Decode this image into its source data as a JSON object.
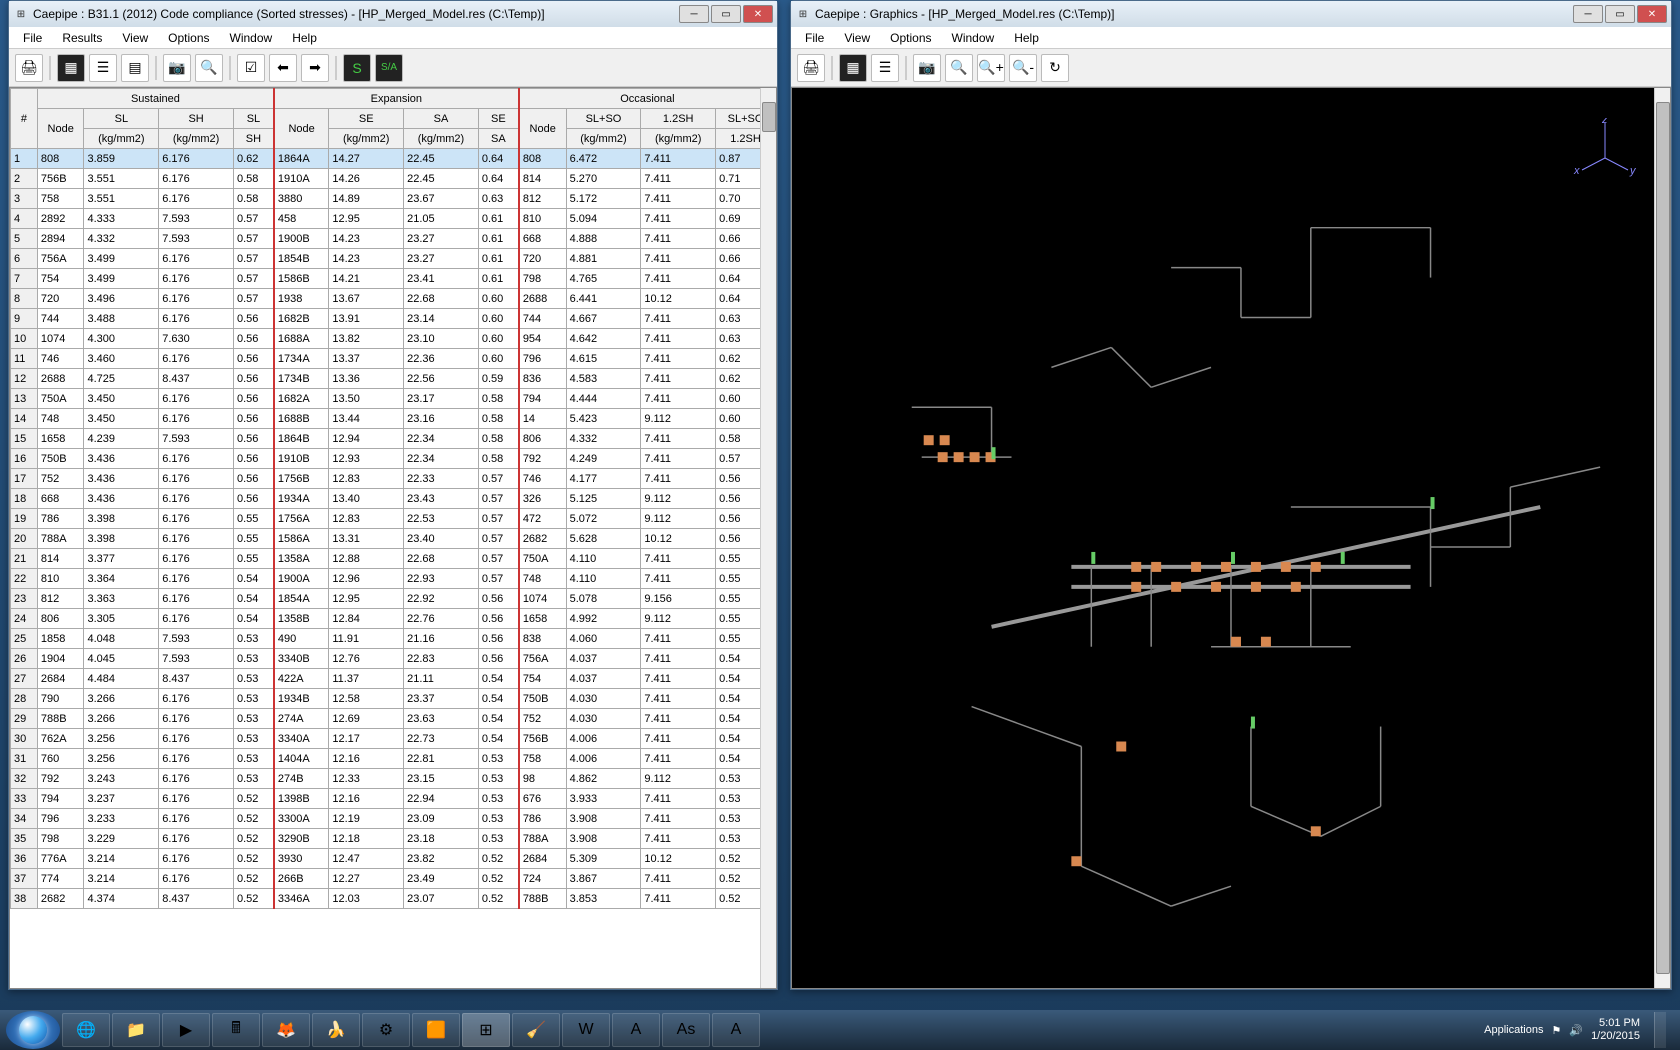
{
  "window_left": {
    "title": "Caepipe : B31.1 (2012) Code compliance (Sorted stresses) -  [HP_Merged_Model.res (C:\\Temp)]",
    "menus": [
      "File",
      "Results",
      "View",
      "Options",
      "Window",
      "Help"
    ],
    "groups": {
      "sustained": "Sustained",
      "expansion": "Expansion",
      "occasional": "Occasional"
    },
    "headers": {
      "num": "#",
      "node": "Node",
      "sl": "SL",
      "sl_u": "(kg/mm2)",
      "sh": "SH",
      "sh_u": "(kg/mm2)",
      "slsh": "SL",
      "slsh2": "SH",
      "se": "SE",
      "se_u": "(kg/mm2)",
      "sa": "SA",
      "sa_u": "(kg/mm2)",
      "sesa": "SE",
      "sesa2": "SA",
      "slso": "SL+SO",
      "slso_u": "(kg/mm2)",
      "sh12": "1.2SH",
      "sh12_u": "(kg/mm2)",
      "ratio_o": "SL+SO",
      "ratio_o2": "1.2SH"
    },
    "rows": [
      {
        "n": "1",
        "s_node": "808",
        "sl": "3.859",
        "sh": "6.176",
        "slsh": "0.62",
        "e_node": "1864A",
        "se": "14.27",
        "sa": "22.45",
        "sesa": "0.64",
        "o_node": "808",
        "slso": "6.472",
        "sh12": "7.411",
        "ro": "0.87"
      },
      {
        "n": "2",
        "s_node": "756B",
        "sl": "3.551",
        "sh": "6.176",
        "slsh": "0.58",
        "e_node": "1910A",
        "se": "14.26",
        "sa": "22.45",
        "sesa": "0.64",
        "o_node": "814",
        "slso": "5.270",
        "sh12": "7.411",
        "ro": "0.71"
      },
      {
        "n": "3",
        "s_node": "758",
        "sl": "3.551",
        "sh": "6.176",
        "slsh": "0.58",
        "e_node": "3880",
        "se": "14.89",
        "sa": "23.67",
        "sesa": "0.63",
        "o_node": "812",
        "slso": "5.172",
        "sh12": "7.411",
        "ro": "0.70"
      },
      {
        "n": "4",
        "s_node": "2892",
        "sl": "4.333",
        "sh": "7.593",
        "slsh": "0.57",
        "e_node": "458",
        "se": "12.95",
        "sa": "21.05",
        "sesa": "0.61",
        "o_node": "810",
        "slso": "5.094",
        "sh12": "7.411",
        "ro": "0.69"
      },
      {
        "n": "5",
        "s_node": "2894",
        "sl": "4.332",
        "sh": "7.593",
        "slsh": "0.57",
        "e_node": "1900B",
        "se": "14.23",
        "sa": "23.27",
        "sesa": "0.61",
        "o_node": "668",
        "slso": "4.888",
        "sh12": "7.411",
        "ro": "0.66"
      },
      {
        "n": "6",
        "s_node": "756A",
        "sl": "3.499",
        "sh": "6.176",
        "slsh": "0.57",
        "e_node": "1854B",
        "se": "14.23",
        "sa": "23.27",
        "sesa": "0.61",
        "o_node": "720",
        "slso": "4.881",
        "sh12": "7.411",
        "ro": "0.66"
      },
      {
        "n": "7",
        "s_node": "754",
        "sl": "3.499",
        "sh": "6.176",
        "slsh": "0.57",
        "e_node": "1586B",
        "se": "14.21",
        "sa": "23.41",
        "sesa": "0.61",
        "o_node": "798",
        "slso": "4.765",
        "sh12": "7.411",
        "ro": "0.64"
      },
      {
        "n": "8",
        "s_node": "720",
        "sl": "3.496",
        "sh": "6.176",
        "slsh": "0.57",
        "e_node": "1938",
        "se": "13.67",
        "sa": "22.68",
        "sesa": "0.60",
        "o_node": "2688",
        "slso": "6.441",
        "sh12": "10.12",
        "ro": "0.64"
      },
      {
        "n": "9",
        "s_node": "744",
        "sl": "3.488",
        "sh": "6.176",
        "slsh": "0.56",
        "e_node": "1682B",
        "se": "13.91",
        "sa": "23.14",
        "sesa": "0.60",
        "o_node": "744",
        "slso": "4.667",
        "sh12": "7.411",
        "ro": "0.63"
      },
      {
        "n": "10",
        "s_node": "1074",
        "sl": "4.300",
        "sh": "7.630",
        "slsh": "0.56",
        "e_node": "1688A",
        "se": "13.82",
        "sa": "23.10",
        "sesa": "0.60",
        "o_node": "954",
        "slso": "4.642",
        "sh12": "7.411",
        "ro": "0.63"
      },
      {
        "n": "11",
        "s_node": "746",
        "sl": "3.460",
        "sh": "6.176",
        "slsh": "0.56",
        "e_node": "1734A",
        "se": "13.37",
        "sa": "22.36",
        "sesa": "0.60",
        "o_node": "796",
        "slso": "4.615",
        "sh12": "7.411",
        "ro": "0.62"
      },
      {
        "n": "12",
        "s_node": "2688",
        "sl": "4.725",
        "sh": "8.437",
        "slsh": "0.56",
        "e_node": "1734B",
        "se": "13.36",
        "sa": "22.56",
        "sesa": "0.59",
        "o_node": "836",
        "slso": "4.583",
        "sh12": "7.411",
        "ro": "0.62"
      },
      {
        "n": "13",
        "s_node": "750A",
        "sl": "3.450",
        "sh": "6.176",
        "slsh": "0.56",
        "e_node": "1682A",
        "se": "13.50",
        "sa": "23.17",
        "sesa": "0.58",
        "o_node": "794",
        "slso": "4.444",
        "sh12": "7.411",
        "ro": "0.60"
      },
      {
        "n": "14",
        "s_node": "748",
        "sl": "3.450",
        "sh": "6.176",
        "slsh": "0.56",
        "e_node": "1688B",
        "se": "13.44",
        "sa": "23.16",
        "sesa": "0.58",
        "o_node": "14",
        "slso": "5.423",
        "sh12": "9.112",
        "ro": "0.60"
      },
      {
        "n": "15",
        "s_node": "1658",
        "sl": "4.239",
        "sh": "7.593",
        "slsh": "0.56",
        "e_node": "1864B",
        "se": "12.94",
        "sa": "22.34",
        "sesa": "0.58",
        "o_node": "806",
        "slso": "4.332",
        "sh12": "7.411",
        "ro": "0.58"
      },
      {
        "n": "16",
        "s_node": "750B",
        "sl": "3.436",
        "sh": "6.176",
        "slsh": "0.56",
        "e_node": "1910B",
        "se": "12.93",
        "sa": "22.34",
        "sesa": "0.58",
        "o_node": "792",
        "slso": "4.249",
        "sh12": "7.411",
        "ro": "0.57"
      },
      {
        "n": "17",
        "s_node": "752",
        "sl": "3.436",
        "sh": "6.176",
        "slsh": "0.56",
        "e_node": "1756B",
        "se": "12.83",
        "sa": "22.33",
        "sesa": "0.57",
        "o_node": "746",
        "slso": "4.177",
        "sh12": "7.411",
        "ro": "0.56"
      },
      {
        "n": "18",
        "s_node": "668",
        "sl": "3.436",
        "sh": "6.176",
        "slsh": "0.56",
        "e_node": "1934A",
        "se": "13.40",
        "sa": "23.43",
        "sesa": "0.57",
        "o_node": "326",
        "slso": "5.125",
        "sh12": "9.112",
        "ro": "0.56"
      },
      {
        "n": "19",
        "s_node": "786",
        "sl": "3.398",
        "sh": "6.176",
        "slsh": "0.55",
        "e_node": "1756A",
        "se": "12.83",
        "sa": "22.53",
        "sesa": "0.57",
        "o_node": "472",
        "slso": "5.072",
        "sh12": "9.112",
        "ro": "0.56"
      },
      {
        "n": "20",
        "s_node": "788A",
        "sl": "3.398",
        "sh": "6.176",
        "slsh": "0.55",
        "e_node": "1586A",
        "se": "13.31",
        "sa": "23.40",
        "sesa": "0.57",
        "o_node": "2682",
        "slso": "5.628",
        "sh12": "10.12",
        "ro": "0.56"
      },
      {
        "n": "21",
        "s_node": "814",
        "sl": "3.377",
        "sh": "6.176",
        "slsh": "0.55",
        "e_node": "1358A",
        "se": "12.88",
        "sa": "22.68",
        "sesa": "0.57",
        "o_node": "750A",
        "slso": "4.110",
        "sh12": "7.411",
        "ro": "0.55"
      },
      {
        "n": "22",
        "s_node": "810",
        "sl": "3.364",
        "sh": "6.176",
        "slsh": "0.54",
        "e_node": "1900A",
        "se": "12.96",
        "sa": "22.93",
        "sesa": "0.57",
        "o_node": "748",
        "slso": "4.110",
        "sh12": "7.411",
        "ro": "0.55"
      },
      {
        "n": "23",
        "s_node": "812",
        "sl": "3.363",
        "sh": "6.176",
        "slsh": "0.54",
        "e_node": "1854A",
        "se": "12.95",
        "sa": "22.92",
        "sesa": "0.56",
        "o_node": "1074",
        "slso": "5.078",
        "sh12": "9.156",
        "ro": "0.55"
      },
      {
        "n": "24",
        "s_node": "806",
        "sl": "3.305",
        "sh": "6.176",
        "slsh": "0.54",
        "e_node": "1358B",
        "se": "12.84",
        "sa": "22.76",
        "sesa": "0.56",
        "o_node": "1658",
        "slso": "4.992",
        "sh12": "9.112",
        "ro": "0.55"
      },
      {
        "n": "25",
        "s_node": "1858",
        "sl": "4.048",
        "sh": "7.593",
        "slsh": "0.53",
        "e_node": "490",
        "se": "11.91",
        "sa": "21.16",
        "sesa": "0.56",
        "o_node": "838",
        "slso": "4.060",
        "sh12": "7.411",
        "ro": "0.55"
      },
      {
        "n": "26",
        "s_node": "1904",
        "sl": "4.045",
        "sh": "7.593",
        "slsh": "0.53",
        "e_node": "3340B",
        "se": "12.76",
        "sa": "22.83",
        "sesa": "0.56",
        "o_node": "756A",
        "slso": "4.037",
        "sh12": "7.411",
        "ro": "0.54"
      },
      {
        "n": "27",
        "s_node": "2684",
        "sl": "4.484",
        "sh": "8.437",
        "slsh": "0.53",
        "e_node": "422A",
        "se": "11.37",
        "sa": "21.11",
        "sesa": "0.54",
        "o_node": "754",
        "slso": "4.037",
        "sh12": "7.411",
        "ro": "0.54"
      },
      {
        "n": "28",
        "s_node": "790",
        "sl": "3.266",
        "sh": "6.176",
        "slsh": "0.53",
        "e_node": "1934B",
        "se": "12.58",
        "sa": "23.37",
        "sesa": "0.54",
        "o_node": "750B",
        "slso": "4.030",
        "sh12": "7.411",
        "ro": "0.54"
      },
      {
        "n": "29",
        "s_node": "788B",
        "sl": "3.266",
        "sh": "6.176",
        "slsh": "0.53",
        "e_node": "274A",
        "se": "12.69",
        "sa": "23.63",
        "sesa": "0.54",
        "o_node": "752",
        "slso": "4.030",
        "sh12": "7.411",
        "ro": "0.54"
      },
      {
        "n": "30",
        "s_node": "762A",
        "sl": "3.256",
        "sh": "6.176",
        "slsh": "0.53",
        "e_node": "3340A",
        "se": "12.17",
        "sa": "22.73",
        "sesa": "0.54",
        "o_node": "756B",
        "slso": "4.006",
        "sh12": "7.411",
        "ro": "0.54"
      },
      {
        "n": "31",
        "s_node": "760",
        "sl": "3.256",
        "sh": "6.176",
        "slsh": "0.53",
        "e_node": "1404A",
        "se": "12.16",
        "sa": "22.81",
        "sesa": "0.53",
        "o_node": "758",
        "slso": "4.006",
        "sh12": "7.411",
        "ro": "0.54"
      },
      {
        "n": "32",
        "s_node": "792",
        "sl": "3.243",
        "sh": "6.176",
        "slsh": "0.53",
        "e_node": "274B",
        "se": "12.33",
        "sa": "23.15",
        "sesa": "0.53",
        "o_node": "98",
        "slso": "4.862",
        "sh12": "9.112",
        "ro": "0.53"
      },
      {
        "n": "33",
        "s_node": "794",
        "sl": "3.237",
        "sh": "6.176",
        "slsh": "0.52",
        "e_node": "1398B",
        "se": "12.16",
        "sa": "22.94",
        "sesa": "0.53",
        "o_node": "676",
        "slso": "3.933",
        "sh12": "7.411",
        "ro": "0.53"
      },
      {
        "n": "34",
        "s_node": "796",
        "sl": "3.233",
        "sh": "6.176",
        "slsh": "0.52",
        "e_node": "3300A",
        "se": "12.19",
        "sa": "23.09",
        "sesa": "0.53",
        "o_node": "786",
        "slso": "3.908",
        "sh12": "7.411",
        "ro": "0.53"
      },
      {
        "n": "35",
        "s_node": "798",
        "sl": "3.229",
        "sh": "6.176",
        "slsh": "0.52",
        "e_node": "3290B",
        "se": "12.18",
        "sa": "23.18",
        "sesa": "0.53",
        "o_node": "788A",
        "slso": "3.908",
        "sh12": "7.411",
        "ro": "0.53"
      },
      {
        "n": "36",
        "s_node": "776A",
        "sl": "3.214",
        "sh": "6.176",
        "slsh": "0.52",
        "e_node": "3930",
        "se": "12.47",
        "sa": "23.82",
        "sesa": "0.52",
        "o_node": "2684",
        "slso": "5.309",
        "sh12": "10.12",
        "ro": "0.52"
      },
      {
        "n": "37",
        "s_node": "774",
        "sl": "3.214",
        "sh": "6.176",
        "slsh": "0.52",
        "e_node": "266B",
        "se": "12.27",
        "sa": "23.49",
        "sesa": "0.52",
        "o_node": "724",
        "slso": "3.867",
        "sh12": "7.411",
        "ro": "0.52"
      },
      {
        "n": "38",
        "s_node": "2682",
        "sl": "4.374",
        "sh": "8.437",
        "slsh": "0.52",
        "e_node": "3346A",
        "se": "12.03",
        "sa": "23.07",
        "sesa": "0.52",
        "o_node": "788B",
        "slso": "3.853",
        "sh12": "7.411",
        "ro": "0.52"
      }
    ]
  },
  "window_right": {
    "title": "Caepipe : Graphics -  [HP_Merged_Model.res (C:\\Temp)]",
    "menus": [
      "File",
      "View",
      "Options",
      "Window",
      "Help"
    ],
    "axes": {
      "x": "x",
      "y": "y",
      "z": "z"
    }
  },
  "taskbar": {
    "applications_label": "Applications",
    "time": "5:01 PM",
    "date": "1/20/2015"
  }
}
